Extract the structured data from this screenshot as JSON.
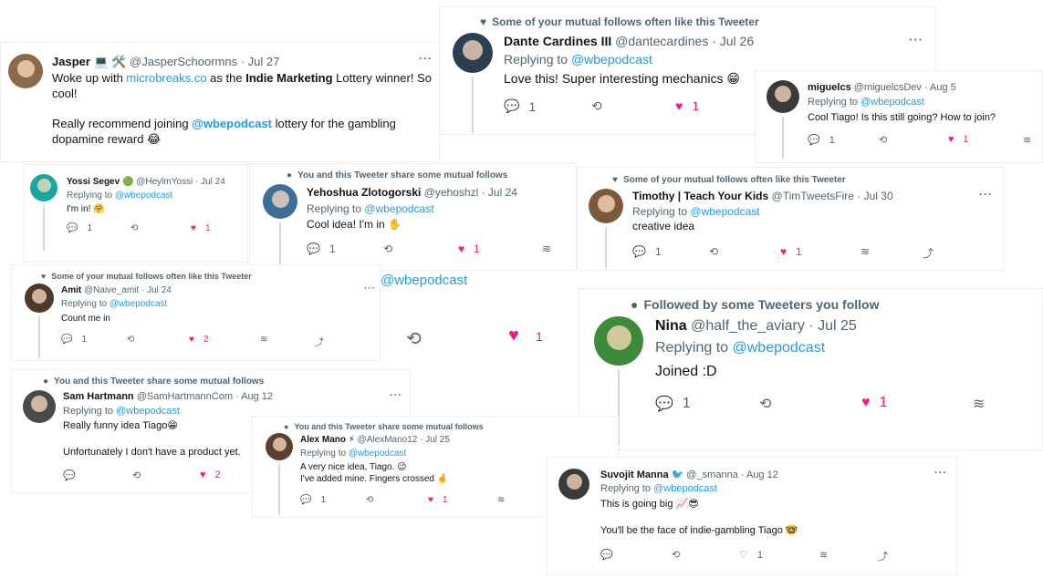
{
  "icons": {
    "reply": "💬",
    "retweet": "⟲",
    "like": "♥",
    "share": "⤴",
    "stack": "≋",
    "more": "···",
    "person": "●"
  },
  "colors": {
    "accent": "#1d9bf0",
    "like": "#f91880",
    "muted": "#536471"
  },
  "tweets": [
    {
      "name": "Jasper 💻 🛠️",
      "handle": "@JasperSchoormns · Jul 27",
      "text1_pre": "Woke up with ",
      "text1_link": "microbreaks.co",
      "text1_mid": " as the ",
      "text1_bold": "Indie Marketing",
      "text1_post": " Lottery winner! So cool!",
      "text2_pre": "Really recommend joining ",
      "text2_mention": "@wbepodcast",
      "text2_post": " lottery for the gambling dopamine reward 😂"
    },
    {
      "context": "Some of your mutual follows often like this Tweeter",
      "name": "Dante Cardines III",
      "handle": "@dantecardines · Jul 26",
      "reply_prefix": "Replying to",
      "reply_to": "@wbepodcast",
      "text": "Love this! Super interesting mechanics 😁",
      "replies": "1",
      "likes": "1"
    },
    {
      "name": "miguelcs",
      "handle": "@miguelcsDev · Aug 5",
      "reply_prefix": "Replying to",
      "reply_to": "@wbepodcast",
      "text": "Cool Tiago! Is this still going? How to join?",
      "replies": "1",
      "likes": "1"
    },
    {
      "name": "Yossi Segev 🟢",
      "handle": "@HeylmYossi · Jul 24",
      "reply_prefix": "Replying to",
      "reply_to": "@wbepodcast",
      "text": "I'm in! 🤗",
      "replies": "1",
      "likes": "1"
    },
    {
      "context": "You and this Tweeter share some mutual follows",
      "name": "Yehoshua Zlotogorski",
      "handle": "@yehoshzl · Jul 24",
      "reply_prefix": "Replying to",
      "reply_to": "@wbepodcast",
      "text": "Cool idea! I'm in ✋",
      "replies": "1",
      "likes": "1"
    },
    {
      "context": "Some of your mutual follows often like this Tweeter",
      "name": "Timothy | Teach Your Kids",
      "handle": "@TimTweetsFire · Jul 30",
      "reply_prefix": "Replying to",
      "reply_to": "@wbepodcast",
      "text": "creative idea",
      "replies": "1",
      "likes": "1"
    },
    {
      "context": "Some of your mutual follows often like this Tweeter",
      "name": "Amit",
      "handle": "@Naive_amit · Jul 24",
      "reply_prefix": "Replying to",
      "reply_to": "@wbepodcast",
      "text": "Count me in",
      "replies": "1",
      "likes": "2"
    },
    {
      "context": "Followed by some Tweeters you follow",
      "name": "Nina",
      "handle": "@half_the_aviary · Jul 25",
      "reply_prefix": "Replying to",
      "reply_to": "@wbepodcast",
      "text": "Joined :D",
      "replies": "1",
      "likes": "1"
    },
    {
      "context": "You and this Tweeter share some mutual follows",
      "name": "Sam Hartmann",
      "handle": "@SamHartmannCom · Aug 12",
      "reply_prefix": "Replying to",
      "reply_to": "@wbepodcast",
      "text1": "Really funny idea Tiago😁",
      "text2": "Unfortunately I don't have a product yet.",
      "likes": "2"
    },
    {
      "context": "You and this Tweeter share some mutual follows",
      "name": "Alex Mano ⚡",
      "handle": "@AlexMano12 · Jul 25",
      "reply_prefix": "Replying to",
      "reply_to": "@wbepodcast",
      "text1": "A very nice idea, Tiago. 😉",
      "text2": "I've added mine. Fingers crossed 🤞",
      "replies": "1",
      "likes": "1"
    },
    {
      "name": "Suvojit Manna 🐦",
      "handle": "@_smanna · Aug 12",
      "reply_prefix": "Replying to",
      "reply_to": "@wbepodcast",
      "text1": "This is going big 📈😎",
      "text2": "You'll be the face of indie-gambling Tiago 🤓",
      "likes": "1"
    }
  ],
  "background_fragment": {
    "mention": "@wbepodcast",
    "likes": "1"
  }
}
